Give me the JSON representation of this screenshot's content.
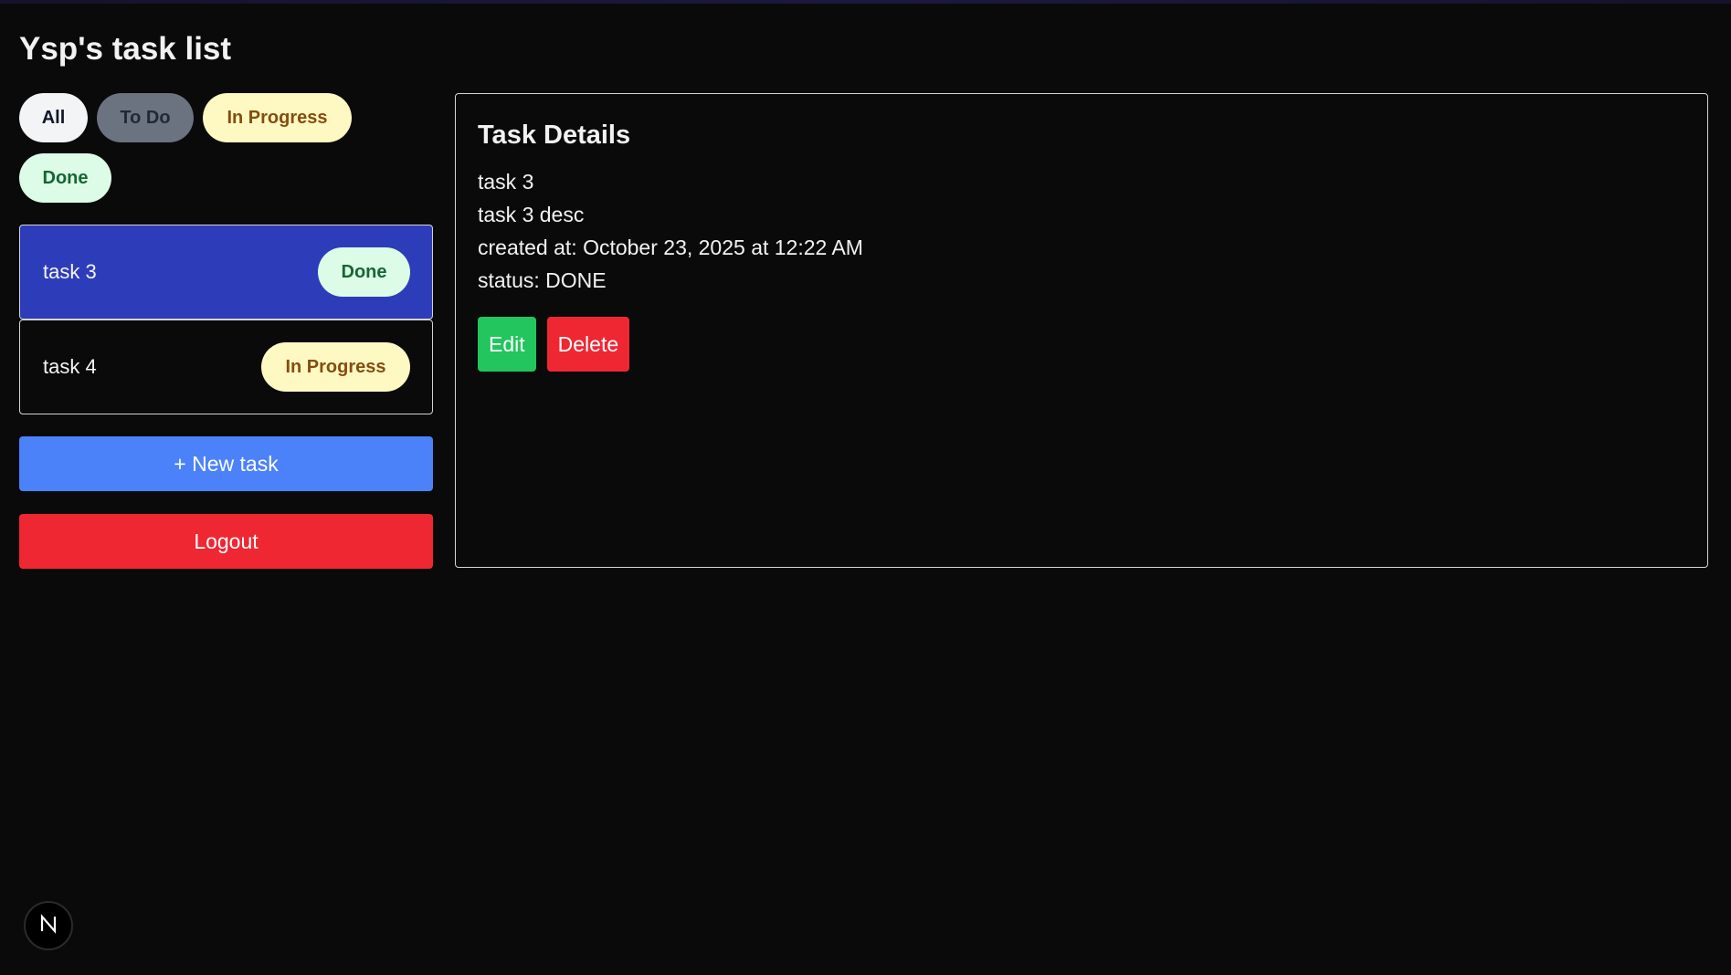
{
  "header": {
    "title": "Ysp's task list"
  },
  "filters": [
    {
      "label": "All"
    },
    {
      "label": "To Do"
    },
    {
      "label": "In Progress"
    },
    {
      "label": "Done"
    }
  ],
  "tasks": [
    {
      "name": "task 3",
      "status": "Done",
      "selected": true
    },
    {
      "name": "task 4",
      "status": "In Progress",
      "selected": false
    }
  ],
  "actions": {
    "new_task_label": "+ New task",
    "logout_label": "Logout"
  },
  "details": {
    "heading": "Task Details",
    "name": "task 3",
    "description": "task 3 desc",
    "created_at": "created at: October 23, 2025 at 12:22 AM",
    "status": "status: DONE",
    "edit_label": "Edit",
    "delete_label": "Delete"
  },
  "colors": {
    "background": "#0a0a0a",
    "selected_task": "#2d3db9",
    "primary_button": "#4b82fa",
    "danger_button": "#ef2733",
    "success_button": "#22c55e"
  },
  "icons": {
    "dev_badge": "next-n-icon"
  }
}
